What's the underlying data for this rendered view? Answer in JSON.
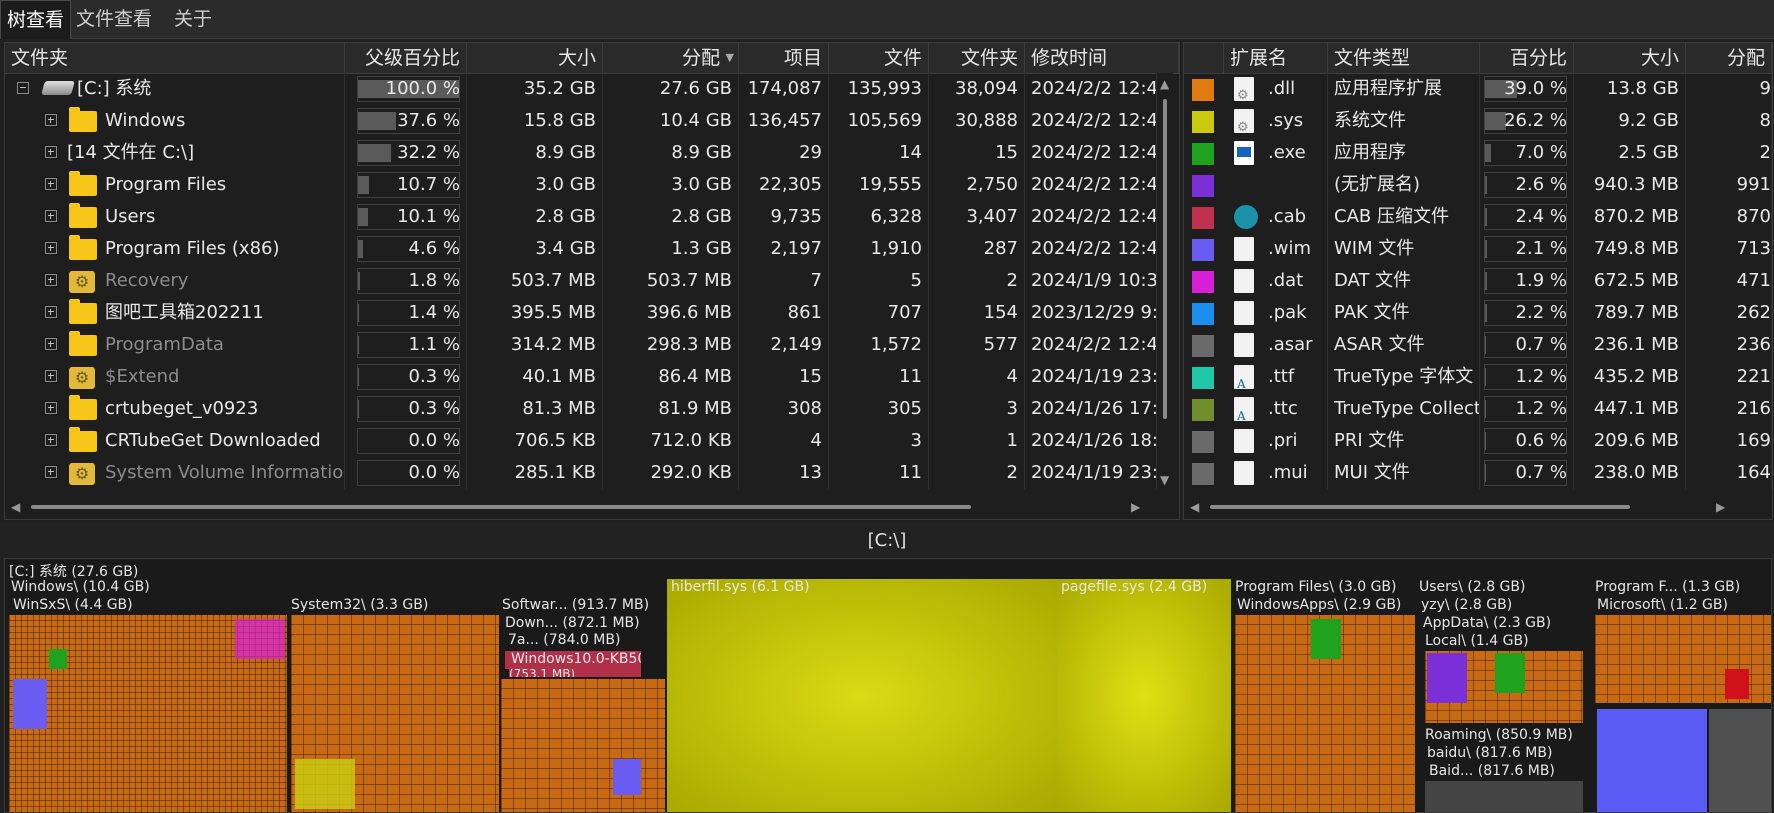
{
  "tabs": [
    "树查看",
    "文件查看",
    "关于"
  ],
  "left": {
    "columns": [
      "文件夹",
      "父级百分比",
      "大小",
      "分配",
      "项目",
      "文件",
      "文件夹",
      "修改时间"
    ],
    "rows": [
      {
        "name": "[C:] 系统",
        "pct": "100.0 %",
        "pctval": 100,
        "size": "35.2 GB",
        "alloc": "27.6 GB",
        "items": "174,087",
        "files": "135,993",
        "folders": "38,094",
        "mtime": "2024/2/2 12:4",
        "icon": "drive-icon",
        "dim": false,
        "root": true
      },
      {
        "name": "Windows",
        "pct": "37.6 %",
        "pctval": 37.6,
        "size": "15.8 GB",
        "alloc": "10.4 GB",
        "items": "136,457",
        "files": "105,569",
        "folders": "30,888",
        "mtime": "2024/2/2 12:4",
        "icon": "folder-icon",
        "dim": false
      },
      {
        "name": "[14 文件在 C:\\]",
        "pct": "32.2 %",
        "pctval": 32.2,
        "size": "8.9 GB",
        "alloc": "8.9 GB",
        "items": "29",
        "files": "14",
        "folders": "15",
        "mtime": "2024/2/2 12:4",
        "icon": "",
        "dim": false
      },
      {
        "name": "Program Files",
        "pct": "10.7 %",
        "pctval": 10.7,
        "size": "3.0 GB",
        "alloc": "3.0 GB",
        "items": "22,305",
        "files": "19,555",
        "folders": "2,750",
        "mtime": "2024/2/2 12:4",
        "icon": "folder-icon",
        "dim": false
      },
      {
        "name": "Users",
        "pct": "10.1 %",
        "pctval": 10.1,
        "size": "2.8 GB",
        "alloc": "2.8 GB",
        "items": "9,735",
        "files": "6,328",
        "folders": "3,407",
        "mtime": "2024/2/2 12:4",
        "icon": "folder-icon",
        "dim": false
      },
      {
        "name": "Program Files (x86)",
        "pct": "4.6 %",
        "pctval": 4.6,
        "size": "3.4 GB",
        "alloc": "1.3 GB",
        "items": "2,197",
        "files": "1,910",
        "folders": "287",
        "mtime": "2024/2/2 12:4",
        "icon": "folder-icon",
        "dim": false
      },
      {
        "name": "Recovery",
        "pct": "1.8 %",
        "pctval": 1.8,
        "size": "503.7 MB",
        "alloc": "503.7 MB",
        "items": "7",
        "files": "5",
        "folders": "2",
        "mtime": "2024/1/9 10:3",
        "icon": "gear-folder-icon",
        "dim": true
      },
      {
        "name": "图吧工具箱202211",
        "pct": "1.4 %",
        "pctval": 1.4,
        "size": "395.5 MB",
        "alloc": "396.6 MB",
        "items": "861",
        "files": "707",
        "folders": "154",
        "mtime": "2023/12/29 9:",
        "icon": "folder-icon",
        "dim": false
      },
      {
        "name": "ProgramData",
        "pct": "1.1 %",
        "pctval": 1.1,
        "size": "314.2 MB",
        "alloc": "298.3 MB",
        "items": "2,149",
        "files": "1,572",
        "folders": "577",
        "mtime": "2024/2/2 12:4",
        "icon": "folder-icon",
        "dim": true
      },
      {
        "name": "$Extend",
        "pct": "0.3 %",
        "pctval": 0.3,
        "size": "40.1 MB",
        "alloc": "86.4 MB",
        "items": "15",
        "files": "11",
        "folders": "4",
        "mtime": "2024/1/19 23:",
        "icon": "gear-folder-icon",
        "dim": true
      },
      {
        "name": "crtubeget_v0923",
        "pct": "0.3 %",
        "pctval": 0.3,
        "size": "81.3 MB",
        "alloc": "81.9 MB",
        "items": "308",
        "files": "305",
        "folders": "3",
        "mtime": "2024/1/26 17:",
        "icon": "folder-icon",
        "dim": false
      },
      {
        "name": "CRTubeGet Downloaded",
        "pct": "0.0 %",
        "pctval": 0,
        "size": "706.5 KB",
        "alloc": "712.0 KB",
        "items": "4",
        "files": "3",
        "folders": "1",
        "mtime": "2024/1/26 18:",
        "icon": "folder-icon",
        "dim": false
      },
      {
        "name": "System Volume Information",
        "pct": "0.0 %",
        "pctval": 0,
        "size": "285.1 KB",
        "alloc": "292.0 KB",
        "items": "13",
        "files": "11",
        "folders": "2",
        "mtime": "2024/1/19 23:",
        "icon": "gear-folder-icon",
        "dim": true
      }
    ]
  },
  "right": {
    "columns": [
      "扩展名",
      "文件类型",
      "百分比",
      "大小",
      "分配"
    ],
    "rows": [
      {
        "ext": ".dll",
        "type": "应用程序扩展",
        "pct": "39.0 %",
        "pctval": 39.0,
        "size": "13.8 GB",
        "alloc": "9",
        "color": "#e07b10",
        "icon": "gearfile"
      },
      {
        "ext": ".sys",
        "type": "系统文件",
        "pct": "26.2 %",
        "pctval": 26.2,
        "size": "9.2 GB",
        "alloc": "8",
        "color": "#c9c910",
        "icon": "gearfile"
      },
      {
        "ext": ".exe",
        "type": "应用程序",
        "pct": "7.0 %",
        "pctval": 7.0,
        "size": "2.5 GB",
        "alloc": "2",
        "color": "#1fa31f",
        "icon": "exe"
      },
      {
        "ext": "",
        "type": "(无扩展名)",
        "pct": "2.6 %",
        "pctval": 2.6,
        "size": "940.3 MB",
        "alloc": "991",
        "color": "#7b2fd6",
        "icon": ""
      },
      {
        "ext": ".cab",
        "type": "CAB 压缩文件",
        "pct": "2.4 %",
        "pctval": 2.4,
        "size": "870.2 MB",
        "alloc": "870",
        "color": "#c0304f",
        "icon": "cab"
      },
      {
        "ext": ".wim",
        "type": "WIM 文件",
        "pct": "2.1 %",
        "pctval": 2.1,
        "size": "749.8 MB",
        "alloc": "713",
        "color": "#6a5cf0",
        "icon": "plain"
      },
      {
        "ext": ".dat",
        "type": "DAT 文件",
        "pct": "1.9 %",
        "pctval": 1.9,
        "size": "672.5 MB",
        "alloc": "471",
        "color": "#d81fd8",
        "icon": "plain"
      },
      {
        "ext": ".pak",
        "type": "PAK 文件",
        "pct": "2.2 %",
        "pctval": 2.2,
        "size": "789.7 MB",
        "alloc": "262",
        "color": "#1a8ff0",
        "icon": "plain"
      },
      {
        "ext": ".asar",
        "type": "ASAR 文件",
        "pct": "0.7 %",
        "pctval": 0.7,
        "size": "236.1 MB",
        "alloc": "236",
        "color": "#6a6a6a",
        "icon": "plain"
      },
      {
        "ext": ".ttf",
        "type": "TrueType 字体文",
        "pct": "1.2 %",
        "pctval": 1.2,
        "size": "435.2 MB",
        "alloc": "221",
        "color": "#1fc9a8",
        "icon": "font"
      },
      {
        "ext": ".ttc",
        "type": "TrueType Collecti",
        "pct": "1.2 %",
        "pctval": 1.2,
        "size": "447.1 MB",
        "alloc": "216",
        "color": "#6f8f2a",
        "icon": "font"
      },
      {
        "ext": ".pri",
        "type": "PRI 文件",
        "pct": "0.6 %",
        "pctval": 0.6,
        "size": "209.6 MB",
        "alloc": "169",
        "color": "#6a6a6a",
        "icon": "plain"
      },
      {
        "ext": ".mui",
        "type": "MUI 文件",
        "pct": "0.7 %",
        "pctval": 0.7,
        "size": "238.0 MB",
        "alloc": "164",
        "color": "#6a6a6a",
        "icon": "plain"
      }
    ]
  },
  "path": "[C:\\]",
  "treemap": {
    "root": "[C:] 系统  (27.6 GB)",
    "windows": "Windows\\ (10.4 GB)",
    "winsxs": "WinSxS\\ (4.4 GB)",
    "system32": "System32\\ (3.3 GB)",
    "software": "Softwar... (913.7 MB)",
    "download": "Down... (872.1 MB)",
    "seven": "7a... (784.0 MB)",
    "kb": "Windows10.0-KB50",
    "kb_size": "(753.1 MB)",
    "hiberfil": "hiberfil.sys (6.1 GB)",
    "pagefile": "pagefile.sys (2.4 GB)",
    "programfiles": "Program Files\\ (3.0 GB)",
    "windowsapps": "WindowsApps\\ (2.9 GB)",
    "users": "Users\\ (2.8 GB)",
    "yzy": "yzy\\ (2.8 GB)",
    "appdata": "AppData\\ (2.3 GB)",
    "local": "Local\\ (1.4 GB)",
    "roaming": "Roaming\\ (850.9 MB)",
    "baidu": "baidu\\ (817.6 MB)",
    "baidu2": "Baid... (817.6 MB)",
    "pf86": "Program F... (1.3 GB)",
    "microsoft": "Microsoft\\ (1.2 GB)"
  }
}
